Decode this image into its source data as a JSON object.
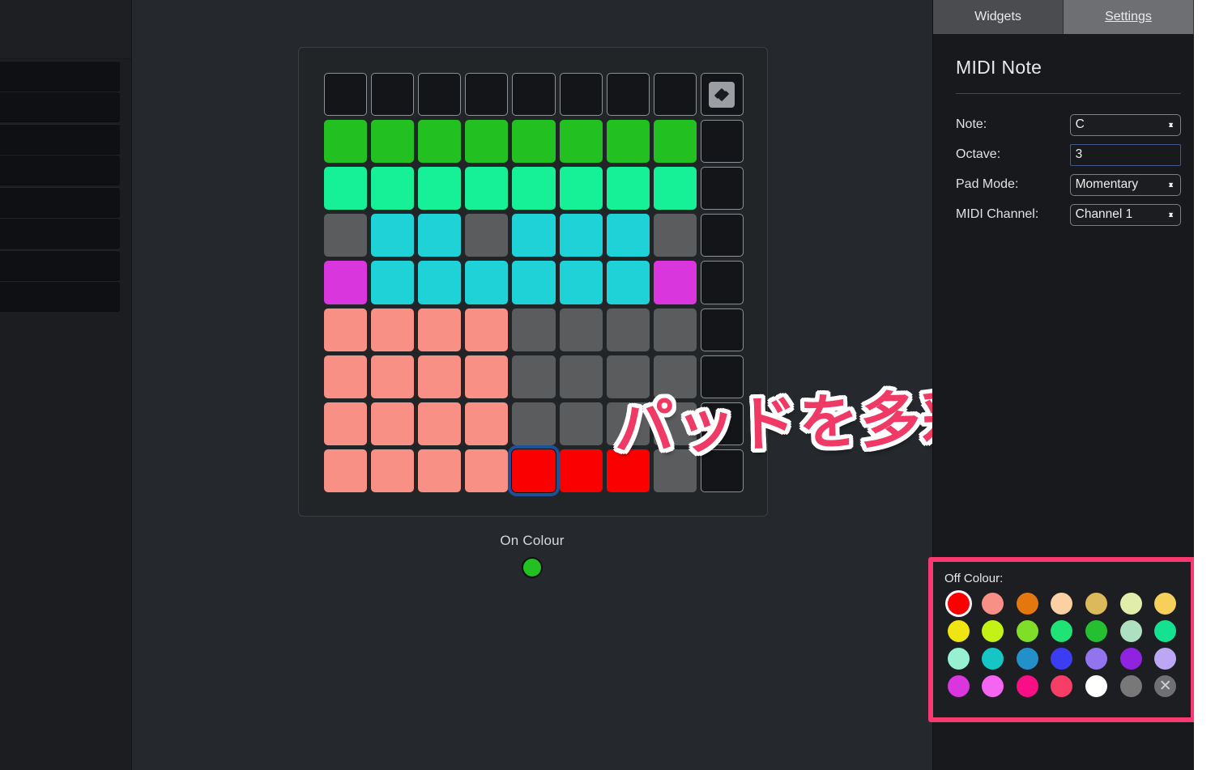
{
  "left_sidebar": {
    "item_count": 8,
    "items": [
      {
        "label": ""
      },
      {
        "label": ""
      },
      {
        "label": ""
      },
      {
        "label": ""
      },
      {
        "label": ""
      },
      {
        "label": ""
      },
      {
        "label": ""
      },
      {
        "label": ""
      }
    ]
  },
  "tabs": [
    {
      "id": "widgets",
      "label": "Widgets",
      "active": false
    },
    {
      "id": "settings",
      "label": "Settings",
      "active": true
    }
  ],
  "settings_panel": {
    "title": "MIDI Note",
    "fields": [
      {
        "id": "note",
        "label": "Note:",
        "value": "C",
        "control": "select"
      },
      {
        "id": "octave",
        "label": "Octave:",
        "value": "3",
        "control": "text"
      },
      {
        "id": "pad_mode",
        "label": "Pad Mode:",
        "value": "Momentary",
        "control": "select"
      },
      {
        "id": "midi_channel",
        "label": "MIDI Channel:",
        "value": "Channel 1",
        "control": "select"
      }
    ]
  },
  "on_colour": {
    "label": "On Colour",
    "value": "#22c021"
  },
  "off_colour": {
    "label": "Off Colour:",
    "selected_index": 0,
    "swatches": [
      "#fb0000",
      "#f99086",
      "#e4780f",
      "#fbd1a4",
      "#dcba5c",
      "#e1eeaa",
      "#f7d05b",
      "#f0e513",
      "#c4f216",
      "#7fde27",
      "#1fe375",
      "#25c031",
      "#addfc0",
      "#15e290",
      "#96f0d1",
      "#16c6c6",
      "#2391c9",
      "#3a3df2",
      "#9174ee",
      "#9023e0",
      "#bca7f5",
      "#d936dd",
      "#f665f1",
      "#f90e86",
      "#f83d66",
      "#ffffff",
      "#787878",
      "clear"
    ]
  },
  "caption": {
    "text": "パッドを多彩に",
    "color": "#ef3a66",
    "outline": "#ffffff"
  },
  "pad_device": {
    "rows": 9,
    "cols": 9,
    "selected": {
      "row": 8,
      "col": 4
    },
    "logo_pad": {
      "row": 0,
      "col": 8,
      "icon": "novation-logo-icon"
    },
    "colors": {
      "empty": "#131518",
      "off": "#5a5c5e",
      "green": "#22c021",
      "spring": "#16f097",
      "cyan": "#1ed2d8",
      "magenta": "#d936dd",
      "salmon": "#f99086",
      "red": "#fb0000"
    },
    "grid": [
      [
        "empty",
        "empty",
        "empty",
        "empty",
        "empty",
        "empty",
        "empty",
        "empty",
        "logo"
      ],
      [
        "green",
        "green",
        "green",
        "green",
        "green",
        "green",
        "green",
        "green",
        "empty"
      ],
      [
        "spring",
        "spring",
        "spring",
        "spring",
        "spring",
        "spring",
        "spring",
        "spring",
        "empty"
      ],
      [
        "off",
        "cyan",
        "cyan",
        "off",
        "cyan",
        "cyan",
        "cyan",
        "off",
        "empty"
      ],
      [
        "magenta",
        "cyan",
        "cyan",
        "cyan",
        "cyan",
        "cyan",
        "cyan",
        "magenta",
        "empty"
      ],
      [
        "salmon",
        "salmon",
        "salmon",
        "salmon",
        "off",
        "off",
        "off",
        "off",
        "empty"
      ],
      [
        "salmon",
        "salmon",
        "salmon",
        "salmon",
        "off",
        "off",
        "off",
        "off",
        "empty"
      ],
      [
        "salmon",
        "salmon",
        "salmon",
        "salmon",
        "off",
        "off",
        "off",
        "off",
        "empty"
      ],
      [
        "salmon",
        "salmon",
        "salmon",
        "salmon",
        "red",
        "red",
        "red",
        "off",
        "empty"
      ]
    ]
  }
}
